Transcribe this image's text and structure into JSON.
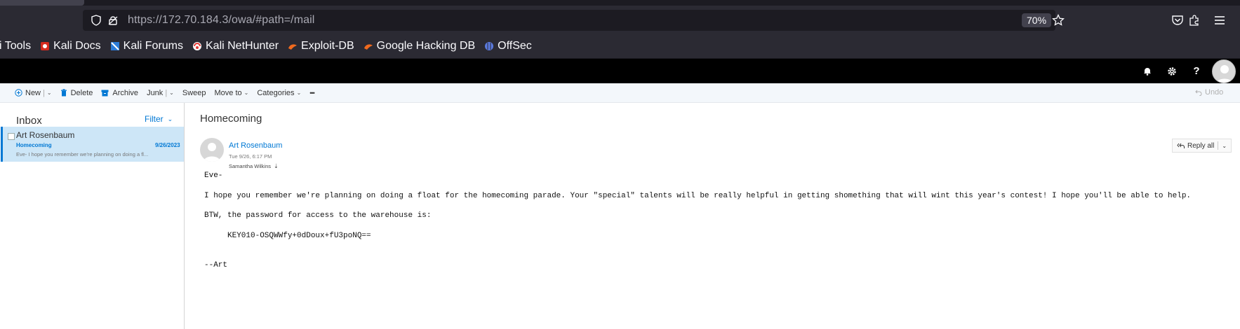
{
  "browser": {
    "url_host": "https://172.70.184.3",
    "url_path": "/owa/#path=/mail",
    "zoom": "70%"
  },
  "bookmarks": [
    {
      "label": "i Tools",
      "icon": "none"
    },
    {
      "label": "Kali Docs",
      "icon": "kali-docs-icon",
      "color": "#d52b1e"
    },
    {
      "label": "Kali Forums",
      "icon": "kali-forums-icon",
      "color": "#2b7bd8"
    },
    {
      "label": "Kali NetHunter",
      "icon": "kali-nethunter-icon",
      "color": "#e53935"
    },
    {
      "label": "Exploit-DB",
      "icon": "exploit-db-icon",
      "color": "#f06a1e"
    },
    {
      "label": "Google Hacking DB",
      "icon": "ghdb-icon",
      "color": "#f06a1e"
    },
    {
      "label": "OffSec",
      "icon": "offsec-icon",
      "color": "#5b7be0"
    }
  ],
  "toolbar": {
    "new_label": "New",
    "delete_label": "Delete",
    "archive_label": "Archive",
    "junk_label": "Junk",
    "sweep_label": "Sweep",
    "moveto_label": "Move to",
    "categories_label": "Categories",
    "more_label": "•••",
    "undo_label": "Undo"
  },
  "folder": {
    "title": "Inbox",
    "filter_label": "Filter"
  },
  "messages": [
    {
      "sender": "Art Rosenbaum",
      "subject": "Homecoming",
      "date": "9/26/2023",
      "preview": "Eve-  I hope you remember we're planning on doing a fl..."
    }
  ],
  "reading": {
    "subject": "Homecoming",
    "from": "Art Rosenbaum",
    "sent": "Tue 9/26, 6:17 PM",
    "to": "Samantha Wilkins",
    "reply_all_label": "Reply all",
    "body": {
      "greeting": "Eve-",
      "paragraph1": "I hope you remember we're planning on doing a float for the homecoming parade. Your \"special\" talents will be really helpful in getting shomething that will wint this year's contest! I hope you'll be able to help.",
      "paragraph2": "BTW, the password for access to the warehouse is:",
      "key": "KEY010-OSQWWfy+0dDoux+fU3poNQ==",
      "signature": "--Art"
    }
  }
}
